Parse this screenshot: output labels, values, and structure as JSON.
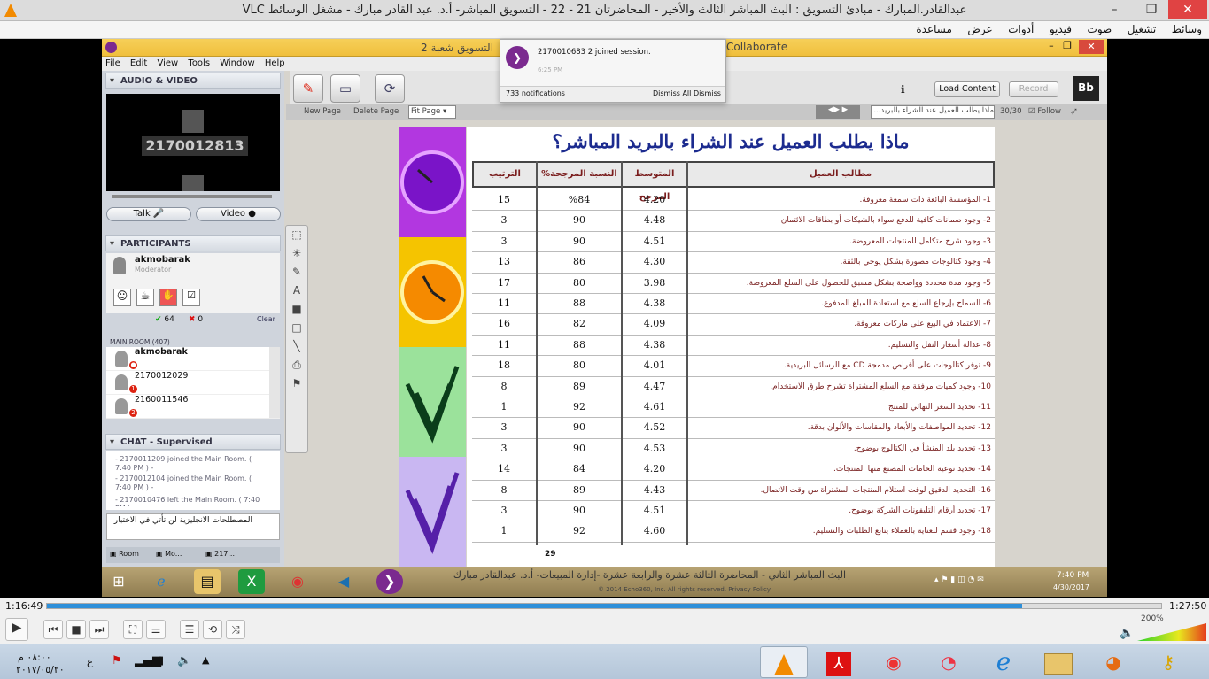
{
  "vlc": {
    "title": "عبدالقادر.المبارك - مبادئ التسويق : البث المباشر الثالث والأخير - المحاضرتان 21 - 22 - التسويق المباشر- أ.د. عبد القادر مبارك - مشغل الوسائط VLC",
    "menu": [
      "وسائط",
      "تشغيل",
      "صوت",
      "فيديو",
      "أدوات",
      "عرض",
      "مساعدة"
    ],
    "time_elapsed": "1:16:49",
    "time_total": "1:27:50",
    "progress": 0.875,
    "volume": "200%"
  },
  "bb": {
    "title_left": "التسويق شعبة 2",
    "title_right": "Collaborate",
    "menu": [
      "File",
      "Edit",
      "View",
      "Tools",
      "Window",
      "Help"
    ],
    "av_header": "AUDIO & VIDEO",
    "video_user": "2170012813",
    "talk": "Talk",
    "video": "Video",
    "participants_header": "PARTICIPANTS",
    "moderator_name": "akmobarak",
    "moderator_role": "Moderator",
    "yes_count": "64",
    "no_count": "0",
    "clear": "Clear",
    "main_room": "MAIN ROOM (407)",
    "participants": [
      {
        "name": "akmobarak",
        "badge": ""
      },
      {
        "name": "2170012029",
        "badge": "1"
      },
      {
        "name": "2160011546",
        "badge": "2"
      }
    ],
    "chat_header": "CHAT - Supervised",
    "chat_lines": [
      "- 2170011209 joined the Main Room. ( 7:40 PM ) -",
      "- 2170012104 joined the Main Room. ( 7:40 PM ) -",
      "- 2170010476 left the Main Room. ( 7:40 PM ) -"
    ],
    "chat_input": "المصطلحات الانجليزية لن تأتي في الاختبار",
    "tabs": [
      "Room",
      "Mo...",
      "217..."
    ],
    "load_content": "Load Content",
    "record": "Record",
    "new_page": "New Page",
    "delete_page": "Delete Page",
    "fit_page": "Fit Page",
    "page_select": "ماذا يطلب العميل عند الشراء بالبريد...",
    "page_count": "30/30",
    "follow": "Follow",
    "notif_text": "2170010683 2 joined session.",
    "notif_time": "6:25 PM",
    "notif_count": "733 notifications",
    "dismiss_all": "Dismiss All",
    "dismiss": "Dismiss",
    "ticker": "البث المباشر الثاني - المحاضرة الثالثة عشرة والرابعة عشرة -إدارة المبيعات- أ.د. عبدالقادر مبارك",
    "copyright": "© 2014 Echo360, Inc. All rights reserved.  Privacy Policy",
    "clock_time": "7:40 PM",
    "clock_date": "4/30/2017"
  },
  "slide": {
    "title": "ماذا يطلب العميل عند الشراء بالبريد المباشر؟",
    "headers": {
      "req": "مطالب العميل",
      "avg": "المتوسط المرجح",
      "pct": "النسبة المرجحة%",
      "rank": "الترتيب"
    },
    "page_no": "29",
    "rows": [
      {
        "req": "1- المؤسسة البائعة ذات سمعة معروفة.",
        "avg": "4.20",
        "pct": "%84",
        "rank": "15"
      },
      {
        "req": "2- وجود ضمانات كافية للدفع سواء بالشيكات أو بطاقات الائتمان",
        "avg": "4.48",
        "pct": "90",
        "rank": "3"
      },
      {
        "req": "3- وجود شرح متكامل للمنتجات المعروضة.",
        "avg": "4.51",
        "pct": "90",
        "rank": "3"
      },
      {
        "req": "4- وجود كتالوجات مصورة بشكل يوحي بالثقة.",
        "avg": "4.30",
        "pct": "86",
        "rank": "13"
      },
      {
        "req": "5- وجود مدة محددة وواضحة بشكل مسبق للحصول على السلع المعروضة.",
        "avg": "3.98",
        "pct": "80",
        "rank": "17"
      },
      {
        "req": "6- السماح بإرجاع السلع مع استعادة المبلغ المدفوع.",
        "avg": "4.38",
        "pct": "88",
        "rank": "11"
      },
      {
        "req": "7- الاعتماد في البيع على ماركات معروفة.",
        "avg": "4.09",
        "pct": "82",
        "rank": "16"
      },
      {
        "req": "8- عدالة أسعار النقل والتسليم.",
        "avg": "4.38",
        "pct": "88",
        "rank": "11"
      },
      {
        "req": "9- توفر كتالوجات على أقراص مدمجة CD مع الرسائل البريدية.",
        "avg": "4.01",
        "pct": "80",
        "rank": "18"
      },
      {
        "req": "10- وجود كميات مرفقة مع السلع المشتراة تشرح طرق الاستخدام.",
        "avg": "4.47",
        "pct": "89",
        "rank": "8"
      },
      {
        "req": "11- تحديد السعر النهائي للمنتج.",
        "avg": "4.61",
        "pct": "92",
        "rank": "1"
      },
      {
        "req": "12- تحديد المواصفات والأبعاد والمقاسات والألوان بدقة.",
        "avg": "4.52",
        "pct": "90",
        "rank": "3"
      },
      {
        "req": "13- تحديد بلد المنشأ في الكتالوج بوضوح.",
        "avg": "4.53",
        "pct": "90",
        "rank": "3"
      },
      {
        "req": "14- تحديد نوعية الخامات المصنع منها المنتجات.",
        "avg": "4.20",
        "pct": "84",
        "rank": "14"
      },
      {
        "req": "16- التحديد الدقيق لوقت استلام المنتجات المشتراة من وقت الاتصال.",
        "avg": "4.43",
        "pct": "89",
        "rank": "8"
      },
      {
        "req": "17- تحديد أرقام التليفونات الشركة بوضوح.",
        "avg": "4.51",
        "pct": "90",
        "rank": "3"
      },
      {
        "req": "18- وجود قسم للعناية بالعملاء يتابع الطلبات والتسليم.",
        "avg": "4.60",
        "pct": "92",
        "rank": "1"
      }
    ]
  },
  "systray": {
    "time": "٠٨:٠٠ م",
    "date": "٢٠١٧/٠٥/٢٠",
    "lang": "ع"
  }
}
